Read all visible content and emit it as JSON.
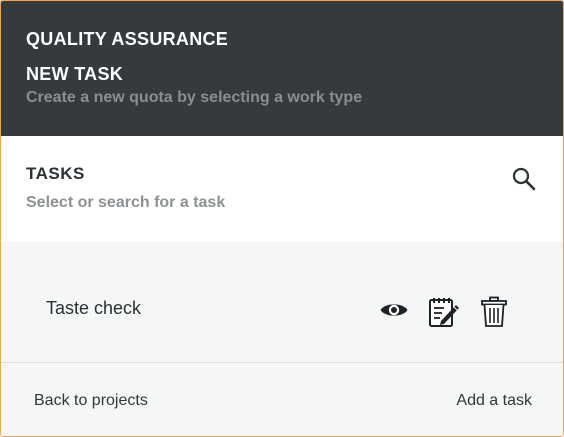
{
  "header": {
    "section_title": "QUALITY ASSURANCE",
    "page_title": "NEW TASK",
    "subtitle": "Create a new quota by selecting a work type"
  },
  "tasks_panel": {
    "title": "TASKS",
    "hint": "Select or search for a task",
    "search_icon": "search-icon"
  },
  "tasks": [
    {
      "name": "Taste check",
      "actions": [
        "eye-icon",
        "notepad-edit-icon",
        "trash-icon"
      ]
    }
  ],
  "footer": {
    "back_label": "Back to projects",
    "add_label": "Add a task"
  },
  "colors": {
    "header_bg": "#353a3f",
    "frame_border": "#f0a35a",
    "panel_bg": "#f5f6f6"
  }
}
